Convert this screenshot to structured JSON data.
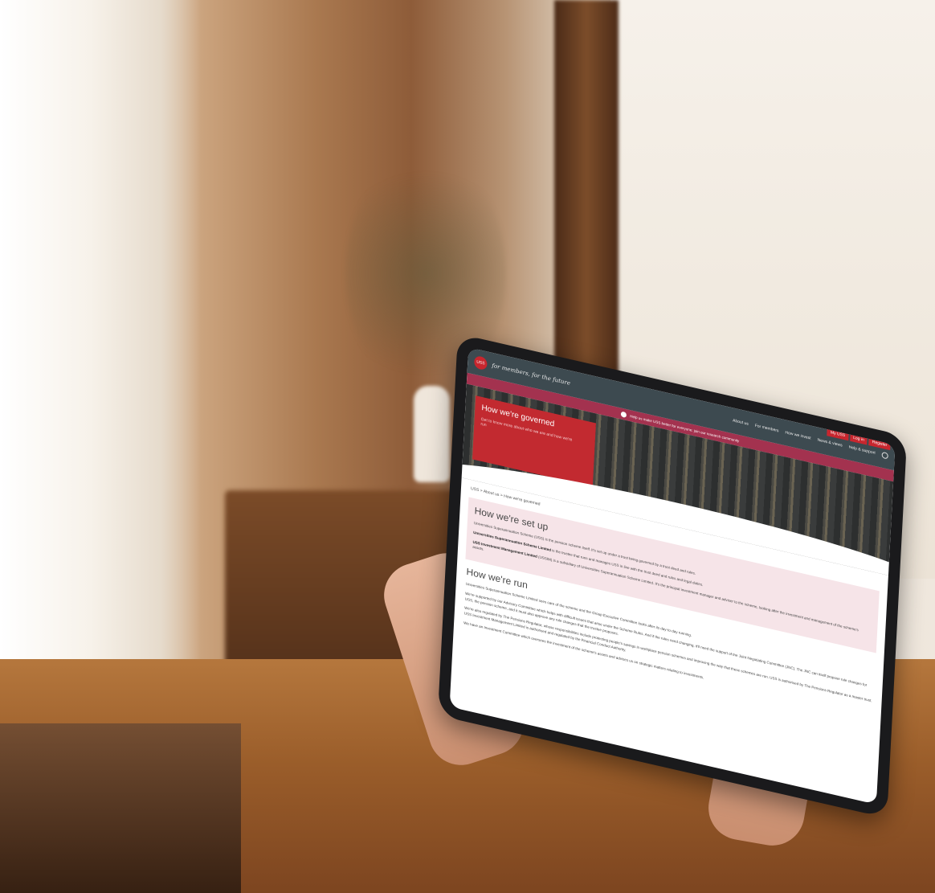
{
  "site": {
    "logo_text": "USS",
    "tagline": "for members, for the future",
    "nav_links": [
      "About us",
      "For members",
      "How we invest",
      "News & views",
      "Help & support"
    ],
    "top_buttons": [
      "My USS",
      "Log in",
      "Register"
    ]
  },
  "banner": {
    "text": "Help us make USS better for everyone: join our research community"
  },
  "hero": {
    "title": "How we're governed",
    "subtitle": "Get to know more about who we are and how we're run"
  },
  "breadcrumb": "USS > About us > How we're governed",
  "setup": {
    "heading": "How we're set up",
    "p1": "Universities Superannuation Scheme (USS) is the pension scheme itself. It's set up under a trust being governed by a trust deed and rules.",
    "p2_bold": "Universities Superannuation Scheme Limited",
    "p2_rest": " is the trustee that runs and manages USS in line with the trust deed and rules and legal duties.",
    "p3_bold": "USS Investment Management Limited",
    "p3_rest": " (USSIM) is a subsidiary of Universities Superannuation Scheme Limited. It's the principal investment manager and adviser to the scheme, looking after the investment and management of the scheme's assets."
  },
  "run": {
    "heading": "How we're run",
    "p1": "Universities Superannuation Scheme Limited sees care of the scheme and the Group Executive Committee looks after its day-to-day running.",
    "p2": "We're supported by our Advisory Committee which helps with difficult issues that arise under the Scheme Rules. And if the rules need changing, it'll need the support of the Joint Negotiating Committee (JNC). The JNC can itself propose rule changes for USS, the pension scheme, and it must also approve any rule changes that the trustee proposes.",
    "p3": "We're also regulated by The Pensions Regulator, whose responsibilities include protecting people's savings in workplace pension schemes and improving the way that these schemes are run. USS is authorised by The Pensions Regulator as a master trust. USS Investment Management Limited is authorised and regulated by the Financial Conduct Authority.",
    "p4": "We have an Investment Committee which oversees the investment of the scheme's assets and advises us on strategic matters relating to investments."
  }
}
